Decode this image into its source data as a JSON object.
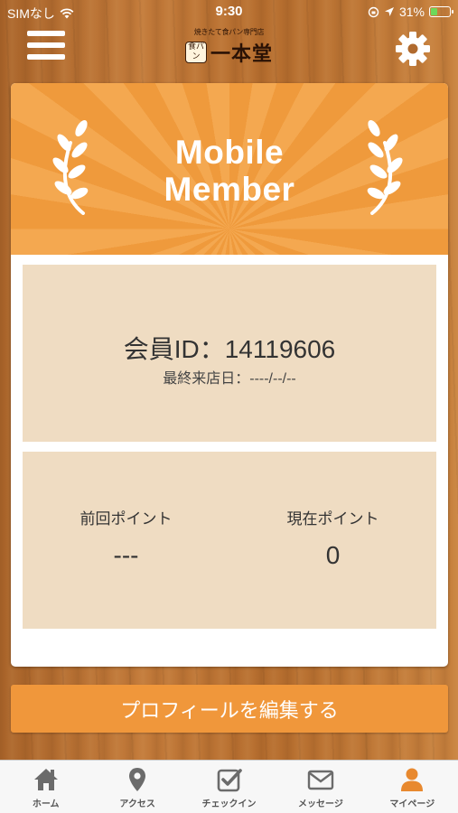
{
  "status_bar": {
    "carrier": "SIMなし",
    "time": "9:30",
    "battery_percent": "31%",
    "battery_level": 0.31,
    "icons": [
      "wifi-icon",
      "orientation-lock-icon",
      "location-arrow-icon",
      "battery-icon"
    ]
  },
  "header": {
    "logo_tagline": "焼きたて食パン専門店",
    "logo_seal": "食パン",
    "logo_name": "一本堂",
    "menu_icon": "hamburger-menu-icon",
    "settings_icon": "gear-icon"
  },
  "banner": {
    "title_line1": "Mobile",
    "title_line2": "Member",
    "decoration": "laurel-icon"
  },
  "member": {
    "id_text": "会員ID：14119606",
    "last_visit_text": "最終来店日：----/--/--"
  },
  "points": {
    "previous_label": "前回ポイント",
    "previous_value": "---",
    "current_label": "現在ポイント",
    "current_value": "0"
  },
  "edit_button_label": "プロフィールを編集する",
  "tabs": [
    {
      "label": "ホーム",
      "icon": "home-icon"
    },
    {
      "label": "アクセス",
      "icon": "map-pin-icon"
    },
    {
      "label": "チェックイン",
      "icon": "checkin-icon"
    },
    {
      "label": "メッセージ",
      "icon": "envelope-icon"
    },
    {
      "label": "マイページ",
      "icon": "user-icon",
      "active": true
    }
  ],
  "colors": {
    "accent_orange": "#f0973b",
    "panel_beige": "#efdcc2",
    "tab_icon": "#6b6b6b",
    "active_tab_icon": "#e8892f"
  }
}
